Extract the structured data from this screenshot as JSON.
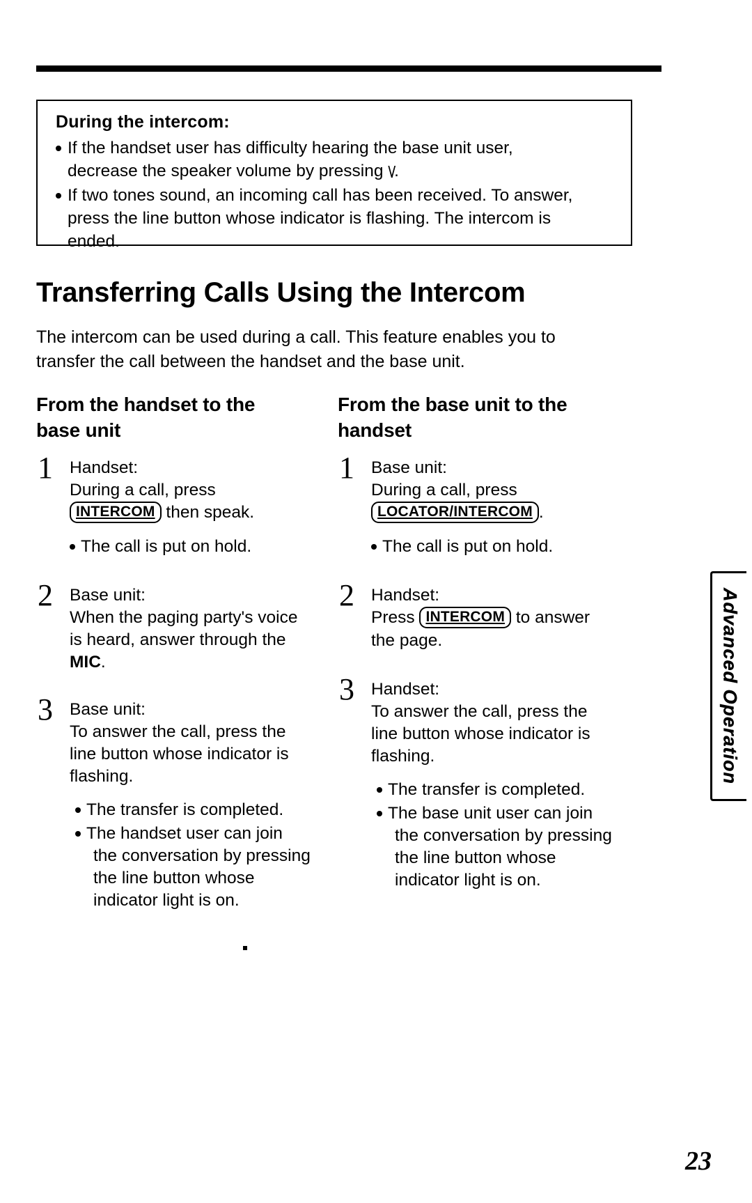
{
  "note": {
    "title": "During the intercom:",
    "bullets": [
      {
        "line1": "If the handset user has difficulty hearing the base unit user,",
        "line2": "decrease the speaker volume by pressing",
        "glyph": "\\/",
        "line2_end": "."
      },
      {
        "line1": "If two tones sound, an incoming call has been received. To answer,",
        "line2": "press the line button whose indicator is flashing. The intercom is",
        "line3": "ended."
      }
    ]
  },
  "section": {
    "title": "Transferring Calls Using the Intercom",
    "intro_line1": "The intercom can be used during a call. This feature enables you to",
    "intro_line2": "transfer the call between the handset and the base unit."
  },
  "left_column": {
    "heading_line1": "From the handset to the",
    "heading_line2": "base unit",
    "steps": [
      {
        "num": "1",
        "who": "Handset:",
        "line1": "During a call, press",
        "key": "INTERCOM",
        "after_key": " then speak.",
        "bullets": [
          "The call is put on hold."
        ]
      },
      {
        "num": "2",
        "who": "Base unit:",
        "line1": "When the paging party's voice",
        "line2": "is heard, answer through the",
        "bold_word": "MIC",
        "after_bold": ".",
        "bullets": []
      },
      {
        "num": "3",
        "who": "Base unit:",
        "line1": "To answer the call, press the",
        "line2": "line button whose indicator is",
        "line3": "flashing.",
        "bullets": [
          "The transfer is completed.",
          "The handset user can join",
          "the conversation by pressing",
          "the line button whose",
          "indicator light is on."
        ]
      }
    ]
  },
  "right_column": {
    "heading_line1": "From the base unit to the",
    "heading_line2": "handset",
    "steps": [
      {
        "num": "1",
        "who": "Base unit:",
        "line1": "During a call, press",
        "key": "LOCATOR/INTERCOM",
        "after_key": ".",
        "bullets": [
          "The call is put on hold."
        ]
      },
      {
        "num": "2",
        "who": "Handset:",
        "pre_key": "Press ",
        "key": "INTERCOM",
        "after_key": " to answer",
        "line2": "the page.",
        "bullets": []
      },
      {
        "num": "3",
        "who": "Handset:",
        "line1": "To answer the call, press the",
        "line2": "line button whose indicator is",
        "line3": "flashing.",
        "bullets": [
          "The transfer is completed.",
          "The base unit user can join",
          "the conversation by pressing",
          "the line button whose",
          "indicator light is on."
        ]
      }
    ]
  },
  "side_tab": {
    "label": "Advanced Operation"
  },
  "footer": {
    "page_number": "23"
  }
}
